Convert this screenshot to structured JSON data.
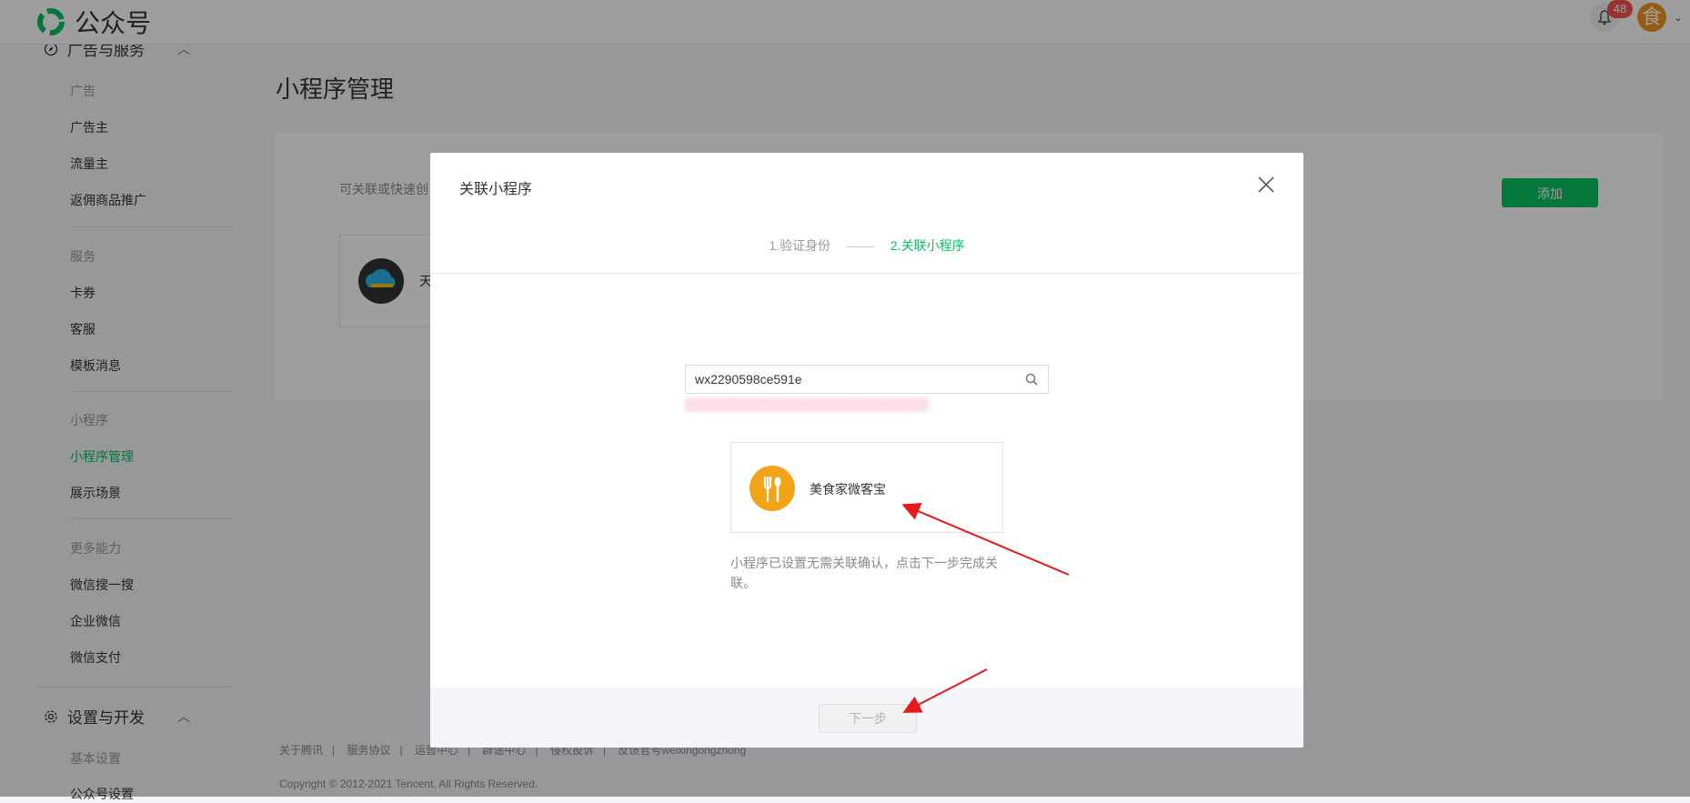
{
  "header": {
    "brand": "公众号",
    "notification_count": "48",
    "avatar_char": "食",
    "avatar_chevron": "⌄"
  },
  "sidebar": {
    "group1_title": "广告与服务",
    "sections": {
      "ads": "广告",
      "services": "服务",
      "mini": "小程序",
      "more": "更多能力"
    },
    "items": {
      "advertiser": "广告主",
      "traffic": "流量主",
      "rebate": "返佣商品推广",
      "coupon": "卡券",
      "customer_service": "客服",
      "template_msg": "模板消息",
      "mini_manage": "小程序管理",
      "scene": "展示场景",
      "wechat_search": "微信搜一搜",
      "work_wechat": "企业微信",
      "wechat_pay": "微信支付"
    },
    "group2_title": "设置与开发",
    "group2_items": {
      "basic": "基本设置",
      "account": "公众号设置"
    }
  },
  "main": {
    "title": "小程序管理",
    "desc": "可关联或快速创",
    "add_button": "添加",
    "linked_mini_name": "天"
  },
  "footer": {
    "links": [
      "关于腾讯",
      "服务协议",
      "运营中心",
      "辟谣中心",
      "侵权投诉",
      "反馈官号weixingongzhong"
    ],
    "separator": "|",
    "copyright": "Copyright © 2012-2021 Tencent. All Rights Reserved."
  },
  "dialog": {
    "title": "关联小程序",
    "step1": "1.验证身份",
    "step2": "2.关联小程序",
    "search_value": "wx2290598ce591e",
    "result_name": "美食家微客宝",
    "hint": "小程序已设置无需关联确认，点击下一步完成关联。",
    "next_button": "下一步"
  },
  "colors": {
    "accent": "#07c160",
    "arrow": "#e8191c",
    "mini_logo": "#f2a419"
  }
}
